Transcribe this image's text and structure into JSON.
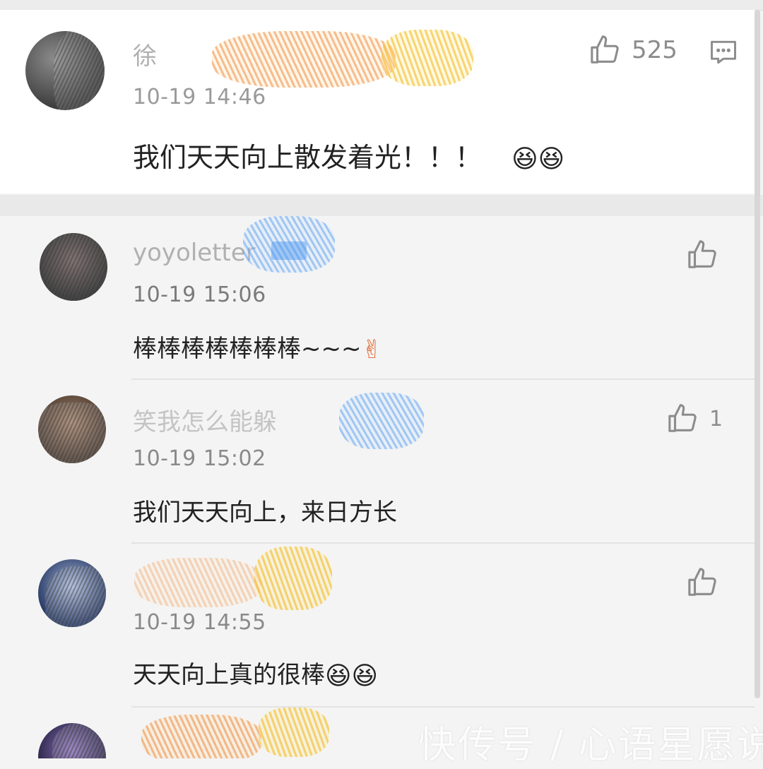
{
  "comments": [
    {
      "username": "徐",
      "time": "10-19 14:46",
      "text": "我们天天向上散发着光！！！",
      "emoji": "😆😆",
      "likes": "525"
    },
    {
      "username": "yoyoletter",
      "time": "10-19 15:06",
      "text": "棒棒棒棒棒棒棒~~~",
      "emoji": "✌",
      "likes": ""
    },
    {
      "username": "笑我怎么能躲",
      "time": "10-19 15:02",
      "text": "我们天天向上，来日方长",
      "emoji": "",
      "likes": "1"
    },
    {
      "username": "",
      "time": "10-19 14:55",
      "text": "天天向上真的很棒",
      "emoji": "😆😆",
      "likes": ""
    }
  ],
  "watermark": "快传号 / 心语星愿说",
  "icons": {
    "like": "thumbs-up-icon",
    "reply": "comment-reply-icon"
  },
  "colors": {
    "card_bg": "#ffffff",
    "page_bg": "#f4f4f4",
    "text": "#222222",
    "meta": "#9a9a9a"
  }
}
